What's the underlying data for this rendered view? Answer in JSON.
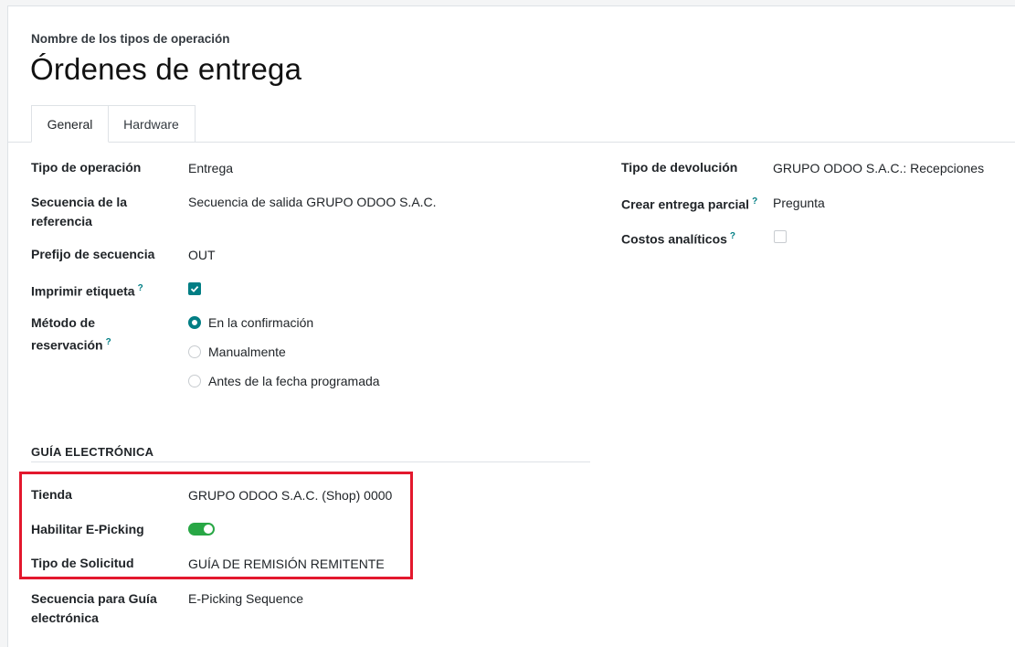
{
  "header": {
    "name_label": "Nombre de los tipos de operación",
    "title": "Órdenes de entrega"
  },
  "tabs": [
    {
      "label": "General",
      "active": true
    },
    {
      "label": "Hardware",
      "active": false
    }
  ],
  "left_fields": {
    "operation_type": {
      "label": "Tipo de operación",
      "value": "Entrega"
    },
    "reference_sequence": {
      "label_line1": "Secuencia de la",
      "label_line2": "referencia",
      "value": "Secuencia de salida GRUPO ODOO S.A.C."
    },
    "sequence_prefix": {
      "label": "Prefijo de secuencia",
      "value": "OUT"
    },
    "print_label": {
      "label": "Imprimir etiqueta",
      "help": "?",
      "checked": true
    },
    "reservation_method": {
      "label_line1": "Método de",
      "label_line2": "reservación",
      "help": "?",
      "options": [
        "En la confirmación",
        "Manualmente",
        "Antes de la fecha programada"
      ],
      "selected": "En la confirmación"
    }
  },
  "right_fields": {
    "return_type": {
      "label": "Tipo de devolución",
      "value": "GRUPO ODOO S.A.C.: Recepciones"
    },
    "partial_delivery": {
      "label": "Crear entrega parcial",
      "help": "?",
      "value": "Pregunta"
    },
    "analytic_costs": {
      "label": "Costos analíticos",
      "help": "?",
      "checked": false
    }
  },
  "guia": {
    "section_title": "GUÍA ELECTRÓNICA",
    "store": {
      "label": "Tienda",
      "value": "GRUPO ODOO S.A.C. (Shop) 0000"
    },
    "epicking": {
      "label": "Habilitar E-Picking",
      "enabled": true
    },
    "request_type": {
      "label": "Tipo de Solicitud",
      "value": "GUÍA DE REMISIÓN REMITENTE"
    },
    "sequence": {
      "label_line1": "Secuencia para Guía",
      "label_line2": "electrónica",
      "value": "E-Picking Sequence"
    }
  },
  "colors": {
    "accent": "#017e84",
    "toggle_on": "#28a745",
    "highlight_border": "#e3182d"
  }
}
